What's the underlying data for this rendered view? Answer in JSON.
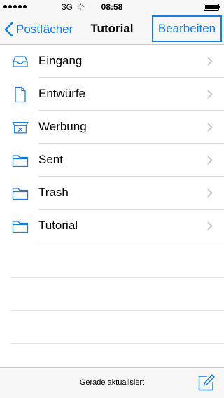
{
  "status_bar": {
    "carrier": "3G",
    "time": "08:58"
  },
  "nav": {
    "back_label": "Postfächer",
    "title": "Tutorial",
    "edit_label": "Bearbeiten"
  },
  "mailboxes": [
    {
      "label": "Eingang",
      "icon": "inbox-tray-icon"
    },
    {
      "label": "Entwürfe",
      "icon": "draft-document-icon"
    },
    {
      "label": "Werbung",
      "icon": "junk-bin-icon"
    },
    {
      "label": "Sent",
      "icon": "folder-icon"
    },
    {
      "label": "Trash",
      "icon": "folder-icon"
    },
    {
      "label": "Tutorial",
      "icon": "folder-icon"
    }
  ],
  "toolbar": {
    "status_text": "Gerade aktualisiert"
  },
  "colors": {
    "accent": "#1a7be0",
    "bar_background": "#f7f7f7",
    "separator": "#d9d9dc"
  }
}
